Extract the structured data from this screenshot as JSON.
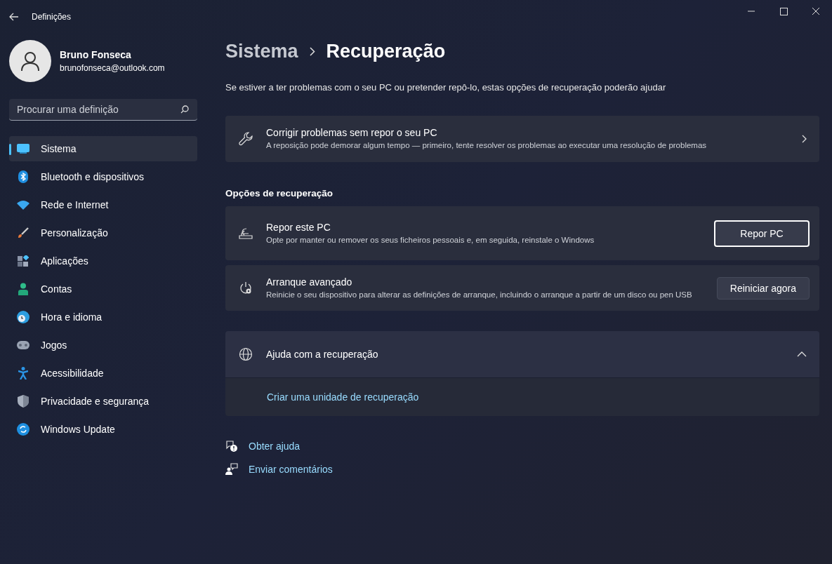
{
  "window": {
    "title": "Definições"
  },
  "account": {
    "name": "Bruno Fonseca",
    "email": "brunofonseca@outlook.com"
  },
  "search": {
    "placeholder": "Procurar uma definição"
  },
  "nav": [
    {
      "label": "Sistema",
      "selected": true
    },
    {
      "label": "Bluetooth e dispositivos",
      "selected": false
    },
    {
      "label": "Rede e Internet",
      "selected": false
    },
    {
      "label": "Personalização",
      "selected": false
    },
    {
      "label": "Aplicações",
      "selected": false
    },
    {
      "label": "Contas",
      "selected": false
    },
    {
      "label": "Hora e idioma",
      "selected": false
    },
    {
      "label": "Jogos",
      "selected": false
    },
    {
      "label": "Acessibilidade",
      "selected": false
    },
    {
      "label": "Privacidade e segurança",
      "selected": false
    },
    {
      "label": "Windows Update",
      "selected": false
    }
  ],
  "breadcrumb": [
    "Sistema",
    "Recuperação"
  ],
  "description": "Se estiver a ter problemas com o seu PC ou pretender repô-lo, estas opções de recuperação poderão ajudar",
  "troubleshoot": {
    "title": "Corrigir problemas sem repor o seu PC",
    "subtitle": "A reposição pode demorar algum tempo — primeiro, tente resolver os problemas ao executar uma resolução de problemas"
  },
  "section_title": "Opções de recuperação",
  "options": [
    {
      "title": "Repor este PC",
      "subtitle": "Opte por manter ou remover os seus ficheiros pessoais e, em seguida, reinstale o Windows",
      "button": "Repor PC",
      "focused": true
    },
    {
      "title": "Arranque avançado",
      "subtitle": "Reinicie o seu dispositivo para alterar as definições de arranque, incluindo o arranque a partir de um disco ou pen USB",
      "button": "Reiniciar agora",
      "focused": false
    }
  ],
  "help": {
    "title": "Ajuda com a recuperação",
    "expanded": true,
    "links": [
      "Criar uma unidade de recuperação"
    ]
  },
  "footer_links": [
    "Obter ajuda",
    "Enviar comentários"
  ]
}
